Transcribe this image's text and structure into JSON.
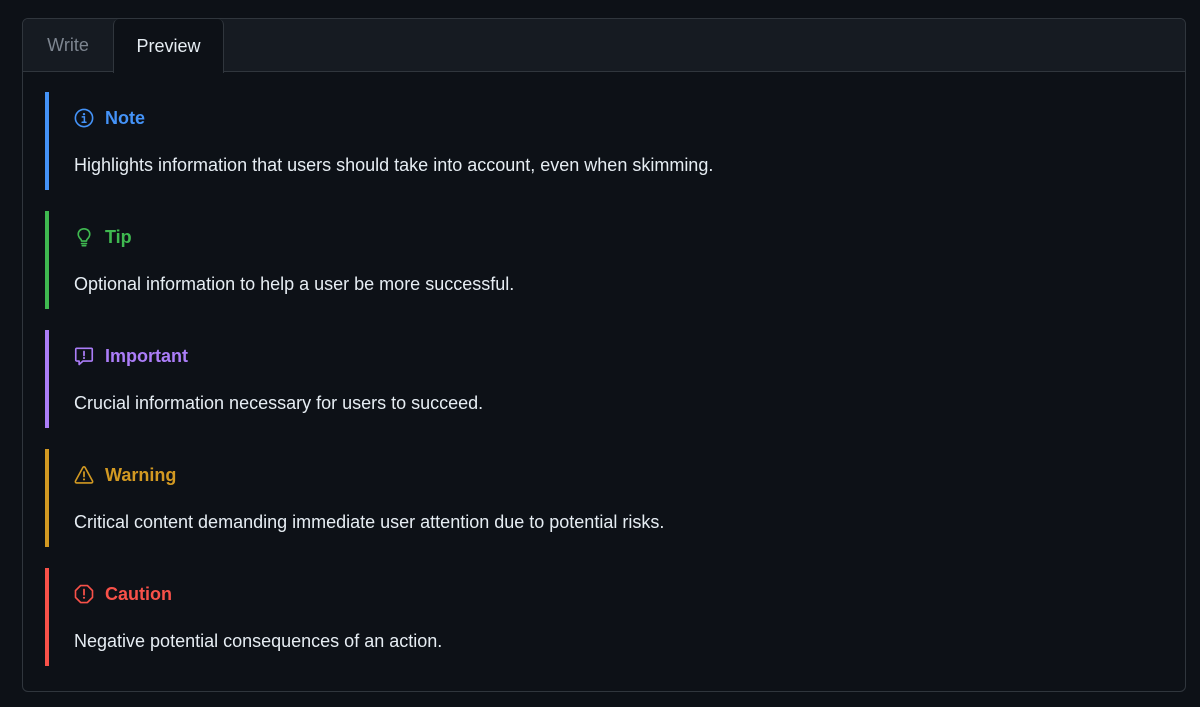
{
  "colors": {
    "background": "#0d1117",
    "note": "#4493f8",
    "tip": "#3fb950",
    "important": "#ab7df8",
    "warning": "#d29922",
    "caution": "#f85149"
  },
  "tabs": {
    "write_label": "Write",
    "preview_label": "Preview",
    "active": "Preview"
  },
  "alerts": [
    {
      "type": "note",
      "icon": "info-icon",
      "title": "Note",
      "body": "Highlights information that users should take into account, even when skimming."
    },
    {
      "type": "tip",
      "icon": "light-bulb-icon",
      "title": "Tip",
      "body": "Optional information to help a user be more successful."
    },
    {
      "type": "important",
      "icon": "report-icon",
      "title": "Important",
      "body": "Crucial information necessary for users to succeed."
    },
    {
      "type": "warning",
      "icon": "alert-icon",
      "title": "Warning",
      "body": "Critical content demanding immediate user attention due to potential risks."
    },
    {
      "type": "caution",
      "icon": "stop-icon",
      "title": "Caution",
      "body": "Negative potential consequences of an action."
    }
  ]
}
